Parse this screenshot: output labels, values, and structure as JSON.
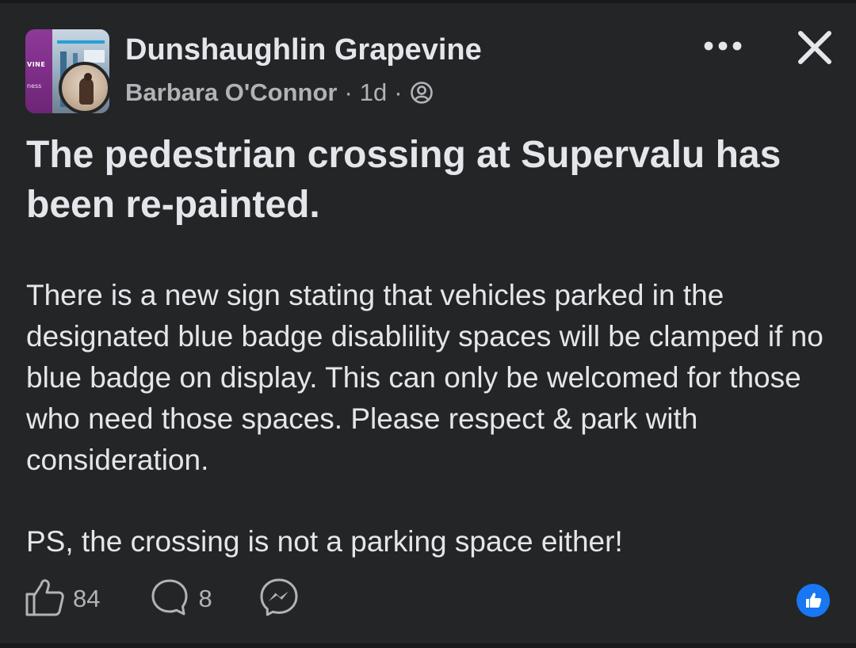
{
  "post": {
    "group_name": "Dunshaughlin Grapevine",
    "author": "Barbara O'Connor",
    "separator": "·",
    "time": "1d",
    "title": "The pedestrian crossing at Supervalu has been re-painted.",
    "body": "There is a new sign stating that vehicles parked in the designated blue badge disablility spaces will be clamped if no blue badge on display. This can only be welcomed for those who need those spaces. Please respect & park with consideration.",
    "ps": "PS, the crossing is not a parking space either!",
    "group_avatar_text_1": "VINE",
    "group_avatar_text_2": "ness"
  },
  "actions": {
    "like_count": "84",
    "comment_count": "8"
  },
  "icons": {
    "privacy": "profile-circle-icon",
    "more": "more-horizontal-icon",
    "close": "close-icon",
    "like": "thumbs-up-outline-icon",
    "comment": "comment-bubble-icon",
    "share": "messenger-icon",
    "reaction": "like-reaction-icon"
  },
  "colors": {
    "background": "#242526",
    "text_primary": "#e4e6eb",
    "text_secondary": "#b0b3b8",
    "accent": "#1877f2"
  }
}
